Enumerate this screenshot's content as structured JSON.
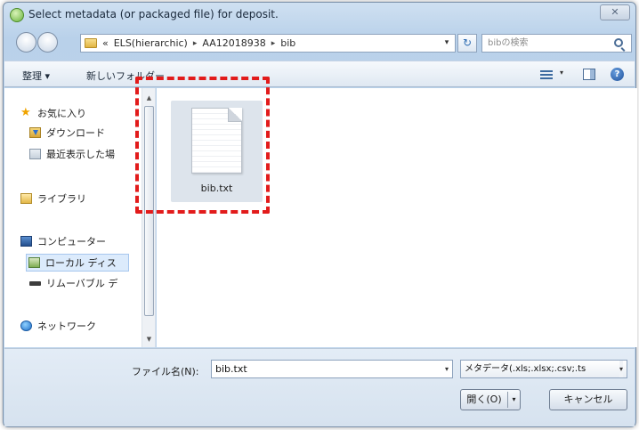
{
  "window": {
    "title": "Select metadata (or packaged file) for deposit.",
    "close_label": "✕"
  },
  "address": {
    "prefix": "«",
    "crumbs": [
      "ELS(hierarchic)",
      "AA12018938",
      "bib"
    ],
    "separator": "▸",
    "dropdown": "▾",
    "refresh": "↻"
  },
  "search": {
    "placeholder": "bibの検索"
  },
  "toolbar": {
    "organize": "整理 ▾",
    "new_folder": "新しいフォルダー",
    "view_dropdown": "▾",
    "help": "?"
  },
  "sidebar": {
    "items": [
      {
        "label": "お気に入り",
        "icon": "star-icon"
      },
      {
        "label": "ダウンロード",
        "icon": "download-folder-icon"
      },
      {
        "label": "最近表示した場",
        "icon": "recent-places-icon"
      },
      {
        "label": "ライブラリ",
        "icon": "library-icon"
      },
      {
        "label": "コンピューター",
        "icon": "computer-icon"
      },
      {
        "label": "ローカル ディス",
        "icon": "local-disk-icon"
      },
      {
        "label": "リムーバブル デ",
        "icon": "removable-drive-icon"
      },
      {
        "label": "ネットワーク",
        "icon": "network-icon"
      }
    ],
    "scroll_up": "▲",
    "scroll_down": "▼"
  },
  "files": [
    {
      "name": "bib.txt",
      "icon": "text-file-icon",
      "selected": true
    }
  ],
  "footer": {
    "filename_label": "ファイル名(N):",
    "filename_value": "bib.txt",
    "filename_dropdown": "▾",
    "filetype": "メタデータ(.xls;.xlsx;.csv;.ts",
    "filetype_dropdown": "▾",
    "open_button": "開く(O)",
    "open_split": "▾",
    "cancel_button": "キャンセル"
  },
  "colors": {
    "highlight": "#e21b1b",
    "selection": "#dcebfc"
  }
}
